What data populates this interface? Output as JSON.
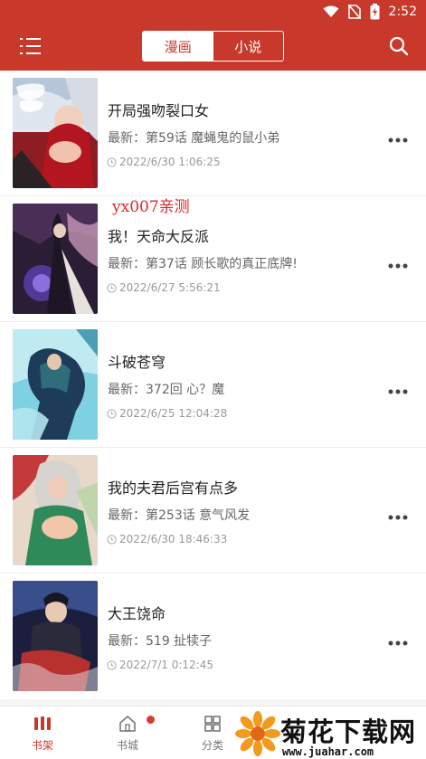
{
  "status_bar": {
    "time": "2:52"
  },
  "header": {
    "tabs": [
      {
        "label": "漫画",
        "active": true
      },
      {
        "label": "小说",
        "active": false
      }
    ],
    "accent_color": "#c8392b"
  },
  "list": {
    "items": [
      {
        "title": "开局强吻裂口女",
        "latest_label": "最新：",
        "latest": "第59话 魔蝇鬼的鼠小弟",
        "time": "2022/6/30 1:06:25"
      },
      {
        "title": "我！天命大反派",
        "latest_label": "最新：",
        "latest": "第37话 顾长歌的真正底牌!",
        "time": "2022/6/27 5:56:21"
      },
      {
        "title": "斗破苍穹",
        "latest_label": "最新：",
        "latest": "372回 心？魔",
        "time": "2022/6/25 12:04:28"
      },
      {
        "title": "我的夫君后宫有点多",
        "latest_label": "最新：",
        "latest": "第253话 意气风发",
        "time": "2022/6/30 18:46:33"
      },
      {
        "title": "大王饶命",
        "latest_label": "最新：",
        "latest": "519 扯犊子",
        "time": "2022/7/1 0:12:45"
      }
    ]
  },
  "watermark": "yx007亲测",
  "bottom_nav": {
    "tabs": [
      {
        "label": "书架",
        "active": true
      },
      {
        "label": "书城",
        "active": false
      },
      {
        "label": "分类",
        "active": false
      }
    ]
  },
  "logo": {
    "brand": "菊花下载网",
    "url": "www.juahar.com"
  }
}
